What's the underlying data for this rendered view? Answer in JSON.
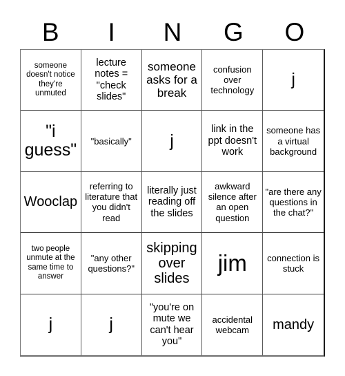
{
  "header": {
    "letters": [
      "B",
      "I",
      "N",
      "G",
      "O"
    ]
  },
  "card": {
    "columns": 5,
    "rows": 5,
    "background_color": "#ffffff",
    "text_color": "#000000",
    "border_color": "#3d3d3d"
  },
  "cells": [
    {
      "text": "someone doesn't notice they’re unmuted",
      "size": "xs"
    },
    {
      "text": "lecture notes = \"check slides\"",
      "size": "md"
    },
    {
      "text": "someone asks for a break",
      "size": "lg"
    },
    {
      "text": "confusion over technology",
      "size": "sm"
    },
    {
      "text": "j",
      "size": "xxl"
    },
    {
      "text": "\"i guess\"",
      "size": "xxl"
    },
    {
      "text": "\"basically\"",
      "size": "sm"
    },
    {
      "text": "j",
      "size": "xxl"
    },
    {
      "text": "link in the ppt doesn't work",
      "size": "md"
    },
    {
      "text": "someone has a virtual background",
      "size": "sm"
    },
    {
      "text": "Wooclap",
      "size": "xl"
    },
    {
      "text": "referring to literature that you didn't read",
      "size": "sm"
    },
    {
      "text": "literally just reading off the slides",
      "size": "md"
    },
    {
      "text": "awkward silence after an open question",
      "size": "sm"
    },
    {
      "text": "\"are there any questions in the chat?\"",
      "size": "sm"
    },
    {
      "text": "two people unmute at the same time to answer",
      "size": "xs"
    },
    {
      "text": "\"any other questions?\"",
      "size": "sm"
    },
    {
      "text": "skipping over slides",
      "size": "xl"
    },
    {
      "text": "jim",
      "size": "huge"
    },
    {
      "text": "connection is stuck",
      "size": "sm"
    },
    {
      "text": "j",
      "size": "xxl"
    },
    {
      "text": "j",
      "size": "xxl"
    },
    {
      "text": "\"you're on mute we can't hear you\"",
      "size": "md"
    },
    {
      "text": "accidental webcam",
      "size": "sm"
    },
    {
      "text": "mandy",
      "size": "xl"
    }
  ]
}
